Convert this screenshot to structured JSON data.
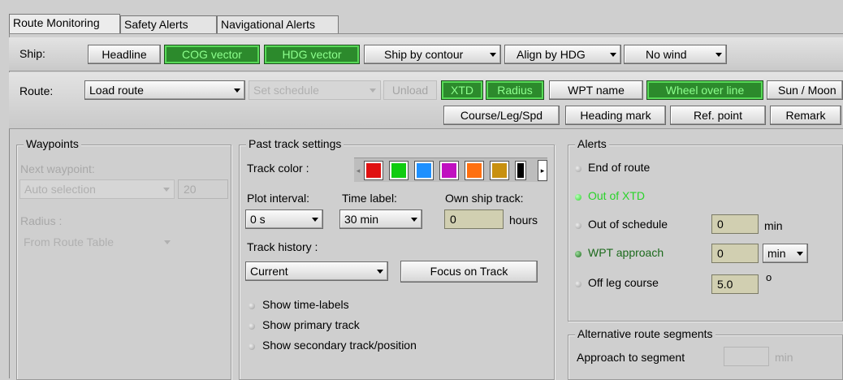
{
  "tabs": [
    "Route Monitoring",
    "Safety Alerts",
    "Navigational Alerts"
  ],
  "ship": {
    "label": "Ship:",
    "headline": "Headline",
    "cog_vector": "COG vector",
    "hdg_vector": "HDG vector",
    "ship_by_contour": "Ship by contour",
    "align_by_hdg": "Align by HDG",
    "no_wind": "No wind"
  },
  "route": {
    "label": "Route:",
    "load_route": "Load route",
    "set_schedule": "Set schedule",
    "unload": "Unload",
    "xtd": "XTD",
    "radius": "Radius",
    "wpt_name": "WPT name",
    "wheel_over_line": "Wheel over line",
    "sun_moon": "Sun / Moon",
    "course_leg_spd": "Course/Leg/Spd",
    "heading_mark": "Heading mark",
    "ref_point": "Ref. point",
    "remark": "Remark"
  },
  "waypoints": {
    "title": "Waypoints",
    "next_label": "Next waypoint:",
    "next_value": "Auto selection",
    "next_num": "20",
    "radius_label": "Radius :",
    "radius_value": "From Route Table"
  },
  "past_track": {
    "title": "Past track settings",
    "track_color_label": "Track color :",
    "colors": [
      "#e01010",
      "#10cc10",
      "#1e90ff",
      "#c010c0",
      "#ff7010",
      "#c89010",
      "#000000"
    ],
    "plot_interval_label": "Plot interval:",
    "plot_interval_value": "0 s",
    "time_label_label": "Time label:",
    "time_label_value": "30 min",
    "own_ship_label": "Own ship track:",
    "own_ship_value": "0",
    "own_ship_unit": "hours",
    "history_label": "Track history :",
    "history_value": "Current",
    "focus_button": "Focus on Track",
    "opt1": "Show time-labels",
    "opt2": "Show primary track",
    "opt3": "Show secondary track/position"
  },
  "alerts": {
    "title": "Alerts",
    "end_of_route": "End of route",
    "out_of_xtd": "Out of XTD",
    "out_of_schedule": "Out of schedule",
    "out_of_schedule_value": "0",
    "out_of_schedule_unit": "min",
    "wpt_approach": "WPT approach",
    "wpt_approach_value": "0",
    "wpt_approach_unit": "min",
    "off_leg": "Off leg course",
    "off_leg_value": "5.0",
    "off_leg_unit": "o"
  },
  "alt_route": {
    "title": "Alternative route segments",
    "approach_label": "Approach to segment",
    "approach_unit": "min"
  }
}
